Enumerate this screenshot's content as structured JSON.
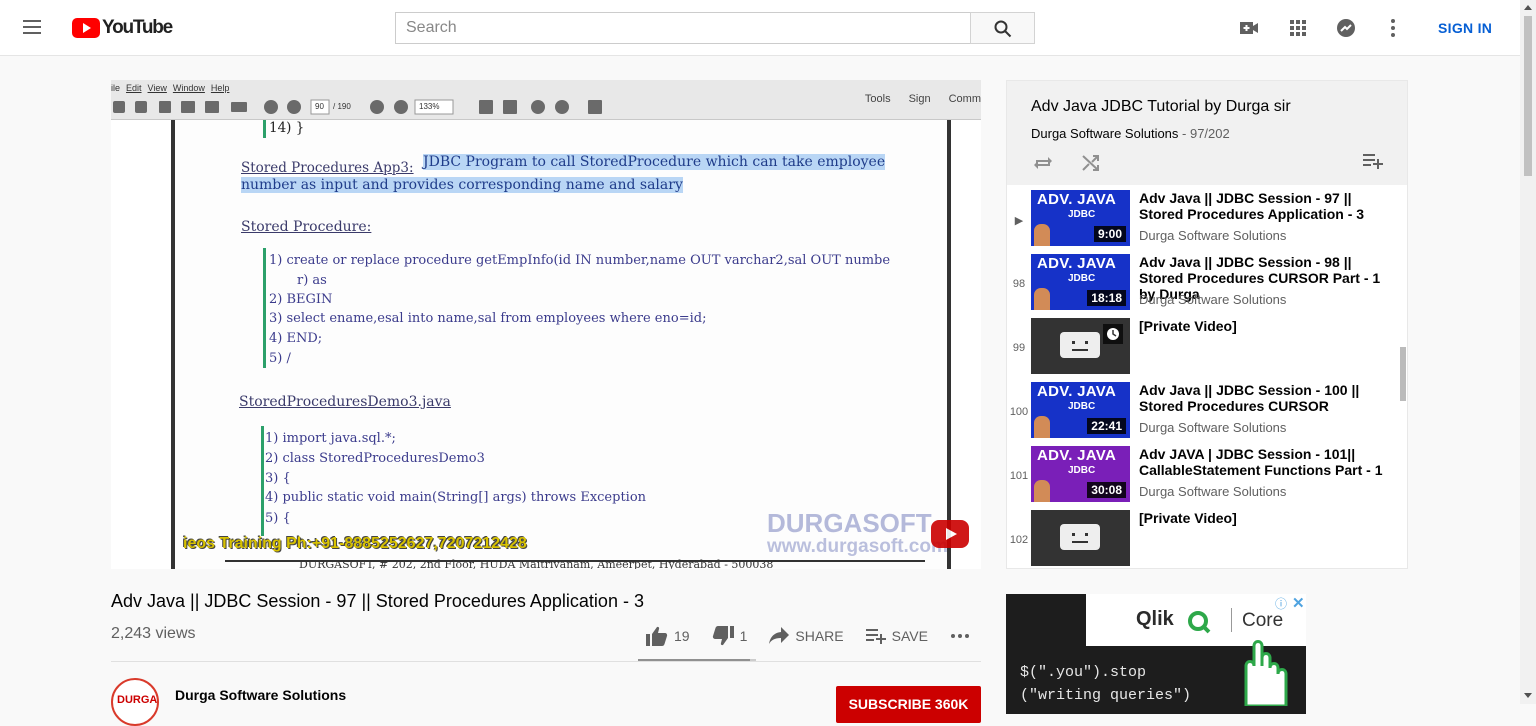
{
  "header": {
    "logo_text": "YouTube",
    "search_placeholder": "Search",
    "signin_label": "SIGN IN"
  },
  "player": {
    "menubar": [
      "ile",
      "Edit",
      "View",
      "Window",
      "Help"
    ],
    "toolbar_page": "90",
    "toolbar_pages": "/ 190",
    "toolbar_zoom": "133%",
    "tools": [
      "Tools",
      "Sign",
      "Comm"
    ],
    "lines": {
      "l0": "14) }",
      "app_title": "Stored Procedures App3:",
      "app_desc1": "JDBC Program to call StoredProcedure which can take employee",
      "app_desc2": "number as input and provides corresponding name and salary",
      "sp_title": "Stored Procedure:",
      "c1": "1)   create or replace procedure getEmpInfo(id IN number,name OUT varchar2,sal OUT numbe",
      "c1b": "r) as",
      "c2": "2)   BEGIN",
      "c3": "3)      select ename,esal into name,sal from employees where eno=id;",
      "c4": "4)   END;",
      "c5": "5)   /",
      "java_title": "StoredProceduresDemo3.java",
      "j1": "1)   import java.sql.*;",
      "j2": "2)   class StoredProceduresDemo3",
      "j3": "3)   {",
      "j4": "4)       public static void main(String[] args) throws Exception",
      "j5": "5)       {",
      "footer": "DURGASOFT, # 202, 2nd Floor, HUDA Maitrivanam, Ameerpet, Hyderabad - 500038"
    },
    "ticker": "ieos Training Ph:+91-8885252627,7207212428",
    "watermark1": "DURGASOFT",
    "watermark2": "www.durgasoft.com"
  },
  "video": {
    "title": "Adv Java || JDBC Session - 97 || Stored Procedures Application - 3",
    "views": "2,243 views",
    "likes": "19",
    "dislikes": "1",
    "share_label": "SHARE",
    "save_label": "SAVE",
    "like_ratio": 0.95
  },
  "channel": {
    "name": "Durga Software Solutions",
    "avatar_text": "DURGA",
    "subscribe_label": "SUBSCRIBE  360K"
  },
  "playlist": {
    "title": "Adv Java JDBC Tutorial by Durga sir",
    "owner": "Durga Software Solutions",
    "position": " - 97/202",
    "items": [
      {
        "index": "▶",
        "title": "Adv Java || JDBC Session - 97 || Stored Procedures Application - 3",
        "channel": "Durga Software Solutions",
        "duration": "9:00",
        "thumb_top": "ADV. JAVA",
        "thumb_mid": "JDBC"
      },
      {
        "index": "98",
        "title": "Adv Java || JDBC Session - 98 || Stored Procedures CURSOR Part - 1 by Durga",
        "channel": "Durga Software Solutions",
        "duration": "18:18",
        "thumb_top": "ADV. JAVA",
        "thumb_mid": "JDBC"
      },
      {
        "index": "99",
        "title": "[Private Video]"
      },
      {
        "index": "100",
        "title": "Adv Java || JDBC Session - 100 || Stored Procedures CURSOR",
        "channel": "Durga Software Solutions",
        "duration": "22:41",
        "thumb_top": "ADV. JAVA",
        "thumb_mid": "JDBC"
      },
      {
        "index": "101",
        "title": "Adv JAVA | JDBC Session - 101|| CallableStatement Functions Part - 1",
        "channel": "Durga Software Solutions",
        "duration": "30:08",
        "thumb_top": "ADV. JAVA",
        "thumb_mid": "JDBC"
      },
      {
        "index": "102",
        "title": "[Private Video]"
      }
    ]
  },
  "ad": {
    "brand": "Qlik",
    "product": "Core",
    "code1": "$(\".you\").stop",
    "code2": "(\"writing queries\")"
  },
  "colors": {
    "accent": "#065fd4",
    "brand_red": "#ff0000",
    "subscribe": "#cc0000",
    "thumb_blue": "#1632c8",
    "thumb_purple": "#7a1fb8"
  }
}
